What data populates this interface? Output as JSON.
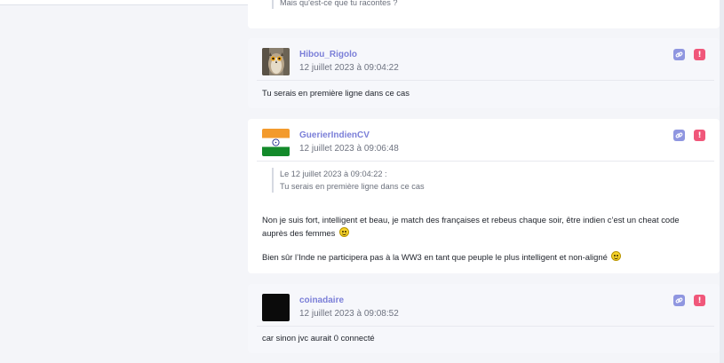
{
  "posts": [
    {
      "quote_tail": "Mais qu'est-ce que tu racontes ?"
    },
    {
      "author": "Hibou_Rigolo",
      "date": "12 juillet 2023 à 09:04:22",
      "avatar": "owl-avatar",
      "message": "Tu serais en première ligne dans ce cas"
    },
    {
      "author": "GuerierIndienCV",
      "date": "12 juillet 2023 à 09:06:48",
      "avatar": "india-flag-avatar",
      "quote_header": "Le 12 juillet 2023 à 09:04:22 :",
      "quote_text": "Tu serais en première ligne dans ce cas",
      "paragraph1": "Non je suis fort, intelligent et beau, je match des françaises et rebeus chaque soir, être indien c’est un cheat code auprès des femmes",
      "paragraph2": "Bien sûr l’Inde ne participera pas à la WW3 en tant que peuple le plus intelligent et non-aligné"
    },
    {
      "author": "coinadaire",
      "date": "12 juillet 2023 à 09:08:52",
      "avatar": "black-avatar",
      "message": "car sinon jvc aurait 0 connecté"
    }
  ],
  "colors": {
    "author": "#7b7fd8",
    "link_button": "#8f96e0",
    "alert_button": "#f0577a",
    "background": "#f4f5f9"
  },
  "icons": {
    "link": "link-icon",
    "alert": "alert-icon",
    "smiley": "smiley-icon"
  },
  "alert_glyph": "!"
}
